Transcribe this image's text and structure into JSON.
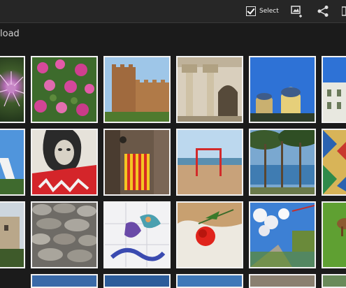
{
  "actionbar": {
    "select_label": "Select",
    "icons": [
      "checkbox-icon",
      "slideshow-icon",
      "share-icon",
      "more-icon"
    ]
  },
  "album": {
    "title_visible": "load"
  },
  "grid": {
    "rows": [
      [
        "pink-thistle-flower",
        "pink-rhododendron-bush",
        "stone-castle-tower",
        "cloister-columns",
        "modernist-building-blue-sky",
        "white-building-blue-sky"
      ],
      [
        "white-structure-blue-sky",
        "street-art-face-graffiti",
        "alley-catalan-flag",
        "beach-goalpost",
        "pine-trees-sea",
        "colorful-tile-mosaic"
      ],
      [
        "stone-village-building",
        "dry-stone-wall",
        "tile-st-george-dragon",
        "red-carnation-white-cloth",
        "white-blossoms-blue-sky",
        "green-field-horse"
      ]
    ]
  },
  "colors": {
    "background": "#1b1b1b",
    "actionbar": "#262626",
    "thumb_border": "#f2f2f2"
  }
}
